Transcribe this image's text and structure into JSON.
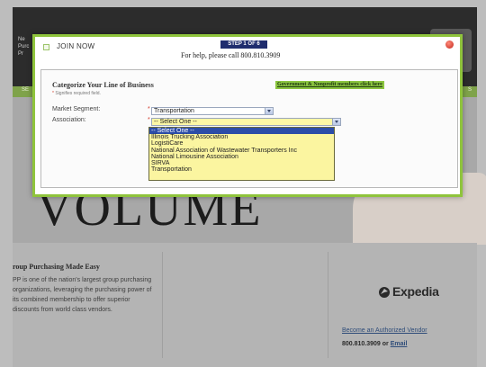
{
  "background": {
    "logo_text": "Ne\nPurc\nPr",
    "green_nav_items": [
      "SE",
      "S"
    ],
    "hero_word": "VOLUME",
    "column_heading": "roup Purchasing Made Easy",
    "paragraph": "PP is one of the nation's largest group purchasing organizations, leveraging the purchasing power of its combined membership to offer superior discounts from world class vendors.",
    "expedia_label": "Expedia",
    "vendor_link": "Become an Authorized Vendor",
    "phone_text": "800.810.3909 or",
    "email_link": "Email"
  },
  "modal": {
    "join_label": "JOIN NOW",
    "step_badge": "STEP 1 OF 6",
    "help_text": "For help, please call 800.810.3909",
    "form": {
      "title": "Categorize Your Line of Business",
      "required_note": "Signifies required field.",
      "required_star": "*",
      "gov_link": "Government & Nonprofit members click here",
      "market_segment": {
        "label": "Market Segment:",
        "value": "Transportation"
      },
      "association": {
        "label": "Association:",
        "value": "-- Select One --",
        "options": [
          "-- Select One --",
          "Illinois Trucking Association",
          "LogistiCare",
          "National Association of Wastewater Transporters Inc",
          "National Limousine Association",
          "SIRVA",
          "Transportation"
        ]
      }
    }
  },
  "colors": {
    "modal_border": "#8fc43c",
    "step_badge_bg": "#1f2d6e",
    "dropdown_bg": "#fbf5a0",
    "dropdown_selected": "#2c4da8"
  }
}
